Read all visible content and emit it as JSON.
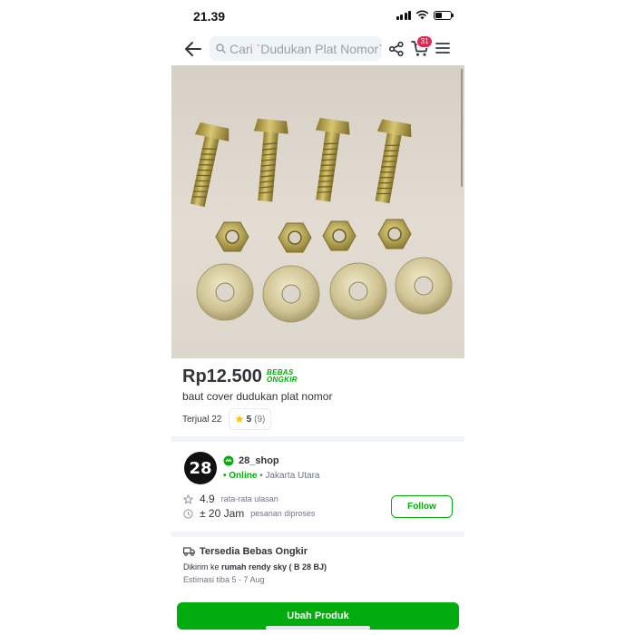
{
  "status_bar": {
    "time": "21.39"
  },
  "header": {
    "search_placeholder": "Cari `Dudukan Plat Nomor` d",
    "cart_count": "31"
  },
  "product": {
    "price": "Rp12.500",
    "free_shipping_badge_line1": "BEBAS",
    "free_shipping_badge_line2": "ONGKIR",
    "name": "baut cover dudukan plat nomor",
    "sold": "Terjual 22",
    "rating": "5",
    "rating_count": "(9)"
  },
  "shop": {
    "avatar_text": "28",
    "name": "28_shop",
    "online_label": "• Online",
    "location": "• Jakarta Utara",
    "rating_value": "4.9",
    "rating_label": "rata-rata ulasan",
    "process_time": "± 20 Jam",
    "process_label": "pesanan diproses",
    "follow_label": "Follow"
  },
  "shipping": {
    "title": "Tersedia Bebas Ongkir",
    "sent_to_prefix": "Dikirim ke",
    "address": "rumah rendy sky ( B 28 BJ)",
    "estimate": "Estimasi tiba 5 - 7 Aug"
  },
  "cta": {
    "label": "Ubah Produk"
  },
  "colors": {
    "primary_green": "#03ac0e",
    "badge_red": "#e02954",
    "text": "#31353b",
    "muted": "#6d7588"
  },
  "icons": [
    "back-arrow-icon",
    "search-icon",
    "share-icon",
    "cart-icon",
    "menu-icon",
    "star-icon",
    "power-merchant-icon",
    "clock-icon",
    "truck-icon"
  ]
}
